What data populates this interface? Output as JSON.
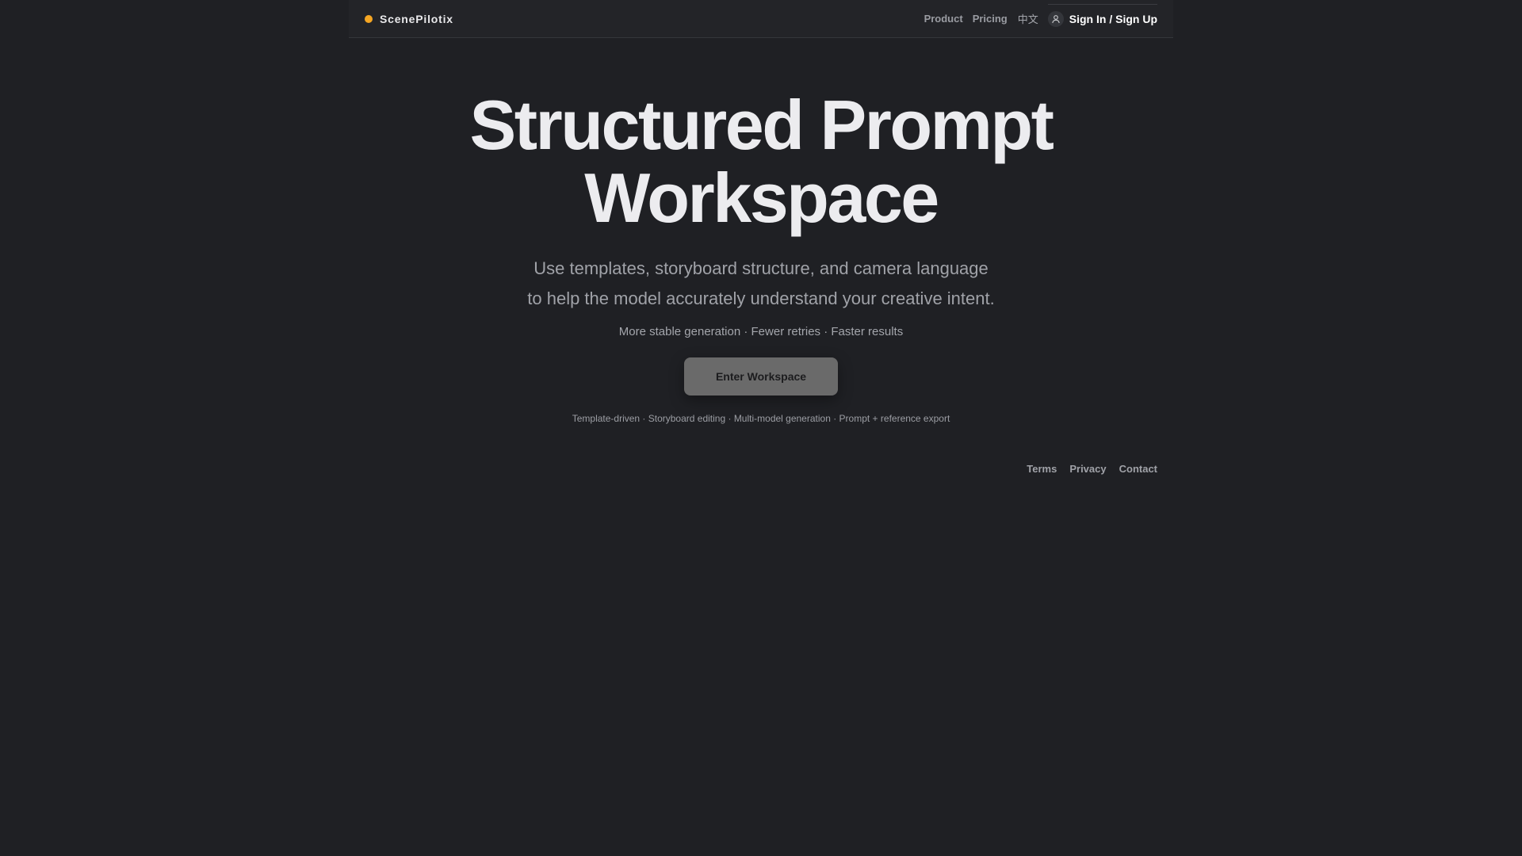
{
  "brand": {
    "name": "ScenePilotix",
    "dot_color": "#f5a623"
  },
  "nav": {
    "product": "Product",
    "pricing": "Pricing",
    "language": "中文",
    "signin": "Sign In / Sign Up",
    "avatar_icon": "user-icon"
  },
  "hero": {
    "title_line1": "Structured Prompt",
    "title_line2": "Workspace",
    "subtitle_line1": "Use templates, storyboard structure, and camera language",
    "subtitle_line2": "to help the model accurately understand your creative intent.",
    "benefits": "More stable generation · Fewer retries · Faster results",
    "cta": "Enter Workspace",
    "features": "Template-driven · Storyboard editing · Multi-model generation · Prompt + reference export"
  },
  "footer": {
    "terms": "Terms",
    "privacy": "Privacy",
    "contact": "Contact"
  }
}
